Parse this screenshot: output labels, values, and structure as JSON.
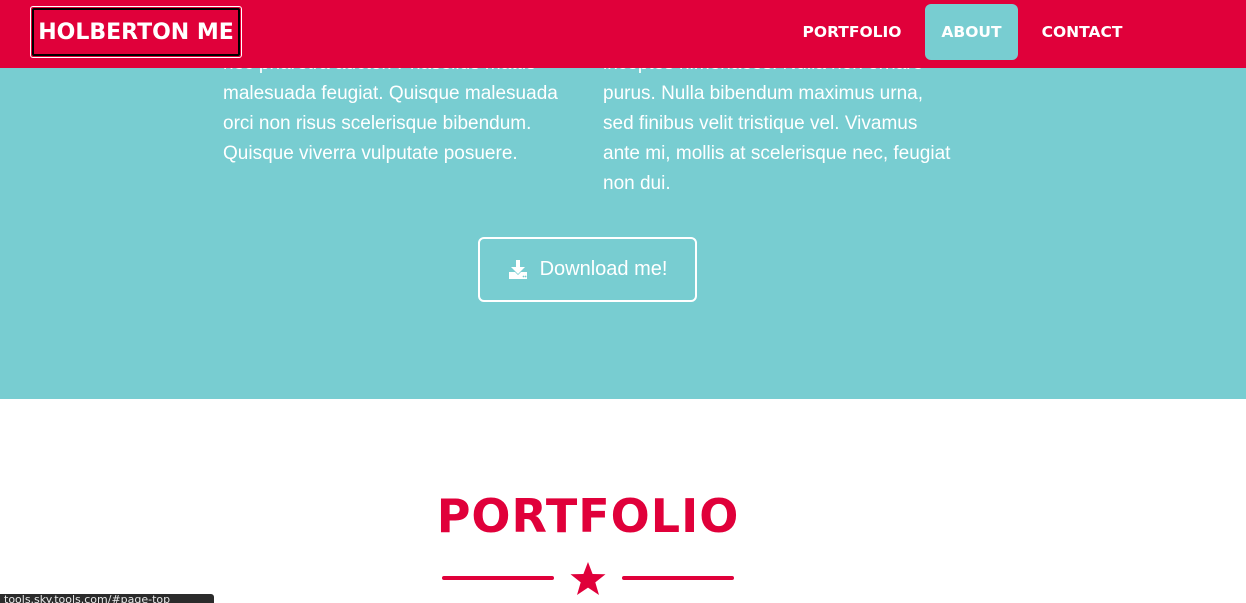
{
  "navbar": {
    "brand": "HOLBERTON ME",
    "links": [
      {
        "label": "PORTFOLIO",
        "active": false
      },
      {
        "label": "ABOUT",
        "active": true
      },
      {
        "label": "CONTACT",
        "active": false
      }
    ]
  },
  "about": {
    "left_paragraph": "nec pharetra auctor. Phasellus mattis malesuada feugiat. Quisque malesuada orci non risus scelerisque bibendum. Quisque viverra vulputate posuere.",
    "right_paragraph": "inceptos himenaeos. Nulla non ornare purus. Nulla bibendum maximus urna, sed finibus velit tristique vel. Vivamus ante mi, mollis at scelerisque nec, feugiat non dui.",
    "download_button": {
      "label": "Download me!",
      "icon": "download-icon"
    }
  },
  "portfolio": {
    "title": "PORTFOLIO",
    "divider_icon": "star-icon"
  },
  "status_bar": {
    "url": "tools.sky.tools.com/#page-top"
  },
  "colors": {
    "primary": "#e0003a",
    "secondary": "#78cdd1",
    "text_light": "#ffffff"
  }
}
